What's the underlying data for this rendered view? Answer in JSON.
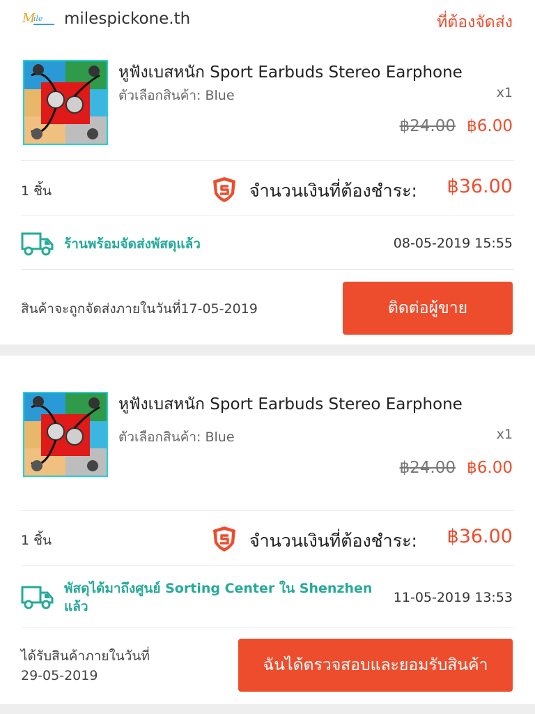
{
  "shop": {
    "name": "milespickone.th",
    "status": "ที่ต้องจัดส่ง",
    "logo_text": "Mile",
    "logo_sub": "pickone"
  },
  "colors": {
    "accent": "#ee4d2d",
    "green": "#26aa99",
    "divider": "#eeeeee"
  },
  "orders": [
    {
      "product": {
        "title": "หูฟังเบสหนัก Sport Earbuds Stereo Earphone",
        "variant": "ตัวเลือกสินค้า: Blue",
        "qty": "x1",
        "price_old": "฿24.00",
        "price_new": "฿6.00",
        "image_icon": "earphone-product-image"
      },
      "count": "1 ชิ้น",
      "total_label": "จำนวนเงินที่ต้องชำระ:",
      "total_amount": "฿36.00",
      "shipping_status": "ร้านพร้อมจัดส่งพัสดุแล้ว",
      "shipping_time": "08-05-2019 15:55",
      "note": "สินค้าจะถูกจัดส่งภายในวันที่17-05-2019",
      "button": "ติดต่อผู้ขาย"
    },
    {
      "product": {
        "title": "หูฟังเบสหนัก Sport Earbuds Stereo Earphone",
        "variant": "ตัวเลือกสินค้า: Blue",
        "qty": "x1",
        "price_old": "฿24.00",
        "price_new": "฿6.00",
        "image_icon": "earphone-product-image"
      },
      "count": "1 ชิ้น",
      "total_label": "จำนวนเงินที่ต้องชำระ:",
      "total_amount": "฿36.00",
      "shipping_status_line1": "พัสดุได้มาถึงศูนย์ Sorting Center ใน Shenzhen",
      "shipping_status_line2": "แล้ว",
      "shipping_time": "11-05-2019 13:53",
      "note_line1": "ได้รับสินค้าภายในวันที่",
      "note_line2": "29-05-2019",
      "button": "ฉันได้ตรวจสอบและยอมรับสินค้า"
    }
  ],
  "icons": {
    "shield": "shield-icon",
    "truck": "truck-icon"
  }
}
